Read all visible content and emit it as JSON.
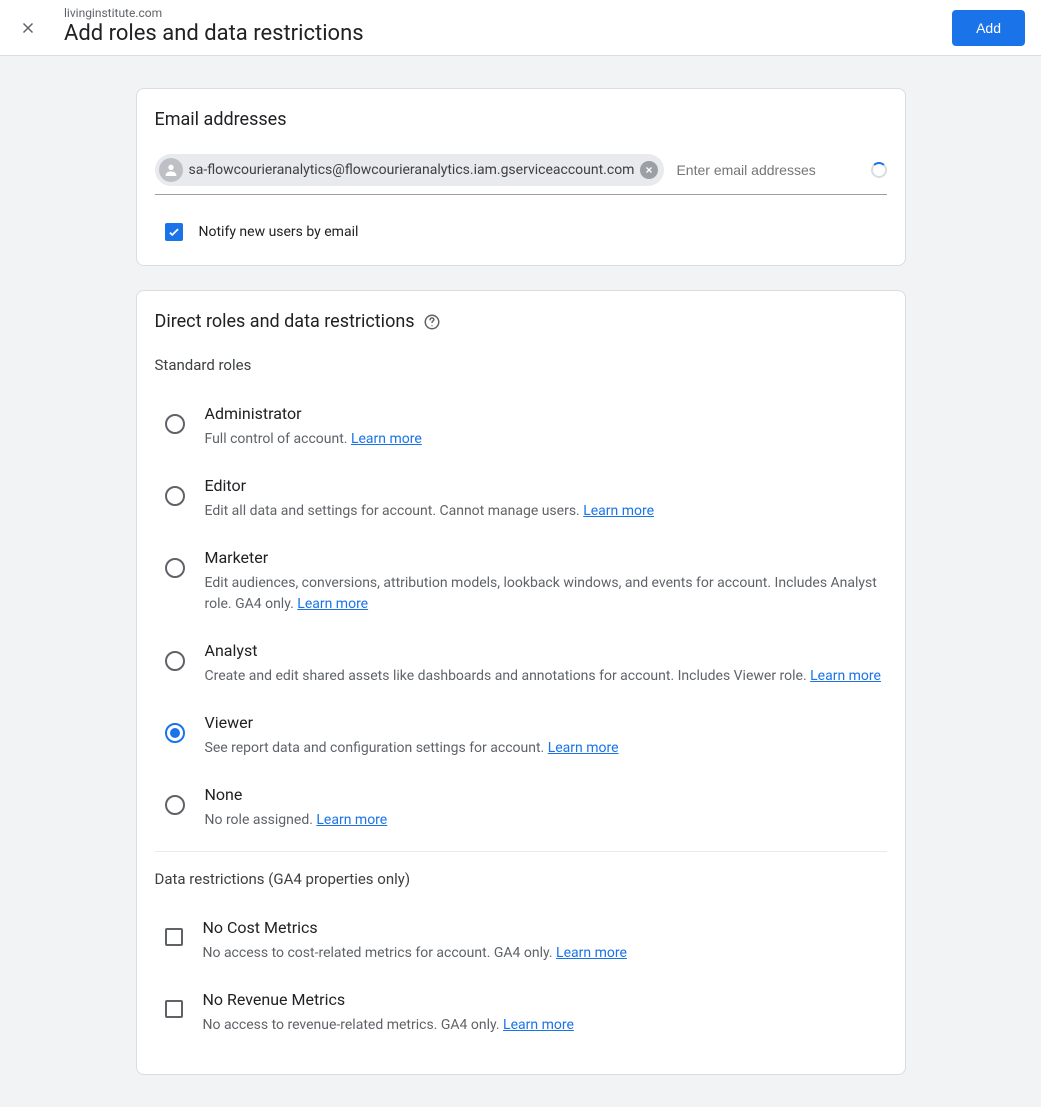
{
  "header": {
    "domain": "livinginstitute.com",
    "title": "Add roles and data restrictions",
    "add_button": "Add"
  },
  "email_card": {
    "title": "Email addresses",
    "chip_email": "sa-flowcourieranalytics@flowcourieranalytics.iam.gserviceaccount.com",
    "input_placeholder": "Enter email addresses",
    "notify_label": "Notify new users by email",
    "notify_checked": true
  },
  "roles_card": {
    "title": "Direct roles and data restrictions",
    "standard_label": "Standard roles",
    "learn_more": "Learn more",
    "roles": [
      {
        "title": "Administrator",
        "desc": "Full control of account.",
        "selected": false
      },
      {
        "title": "Editor",
        "desc": "Edit all data and settings for account. Cannot manage users.",
        "selected": false
      },
      {
        "title": "Marketer",
        "desc": "Edit audiences, conversions, attribution models, lookback windows, and events for account. Includes Analyst role. GA4 only.",
        "selected": false
      },
      {
        "title": "Analyst",
        "desc": "Create and edit shared assets like dashboards and annotations for account. Includes Viewer role.",
        "selected": false
      },
      {
        "title": "Viewer",
        "desc": "See report data and configuration settings for account.",
        "selected": true
      },
      {
        "title": "None",
        "desc": "No role assigned.",
        "selected": false
      }
    ],
    "restrictions_label": "Data restrictions (GA4 properties only)",
    "restrictions": [
      {
        "title": "No Cost Metrics",
        "desc": "No access to cost-related metrics for account. GA4 only.",
        "checked": false
      },
      {
        "title": "No Revenue Metrics",
        "desc": "No access to revenue-related metrics. GA4 only.",
        "checked": false
      }
    ]
  }
}
